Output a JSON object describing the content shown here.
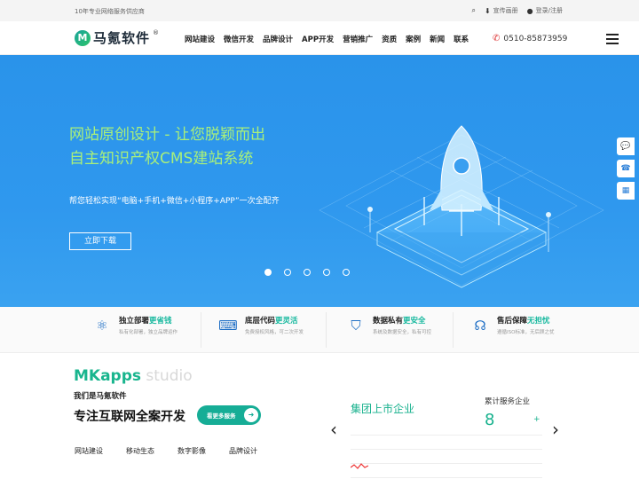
{
  "topbar": {
    "slogan": "10年专业网络服务供应商",
    "links": [
      {
        "icon": "search-icon",
        "label": ""
      },
      {
        "icon": "download-icon",
        "label": "宣传画册"
      },
      {
        "icon": "user-icon",
        "label": "登录/注册"
      }
    ]
  },
  "header": {
    "logo_mark": "M",
    "logo_text": "马氪软件",
    "logo_reg": "®",
    "nav": [
      "网站建设",
      "微信开发",
      "品牌设计",
      "APP开发",
      "营销推广",
      "资质",
      "案例",
      "新闻",
      "联系"
    ],
    "phone": "0510-85873959"
  },
  "banner": {
    "title_line1": "网站原创设计 - 让您脱颖而出",
    "title_line2": "自主知识产权CMS建站系统",
    "subtitle": "帮您轻松实现“电脑+手机+微信+小程序+APP”一次全配齐",
    "button": "立即下载",
    "slides": 5,
    "active_slide": 0
  },
  "features": [
    {
      "icon": "network-icon",
      "title": "独立部署",
      "highlight": "更省钱",
      "desc": "私有化部署，独立品牌运作"
    },
    {
      "icon": "code-icon",
      "title": "底层代码",
      "highlight": "更灵活",
      "desc": "免费授权风格，可二次开发"
    },
    {
      "icon": "shield-icon",
      "title": "数据私有",
      "highlight": "更安全",
      "desc": "系统及数据安全，私有可控"
    },
    {
      "icon": "headset-icon",
      "title": "售后保障",
      "highlight": "无担忧",
      "desc": "遵循ISO标准，无后顾之忧"
    }
  ],
  "about": {
    "brand_a": "MKapps",
    "brand_b": " studio",
    "who": "我们是马氪软件",
    "slogan": "专注互联网全案开发",
    "more_button": "看更多服务",
    "services": [
      "网站建设",
      "移动生态",
      "数字影像",
      "品牌设计"
    ],
    "group_label": "集团上市企业",
    "counter_label": "累计服务企业",
    "counter_value": "8",
    "counter_plus": "+"
  },
  "colors": {
    "accent": "#16b89e",
    "banner": "#2f98ee",
    "headline": "#a9f07a"
  }
}
